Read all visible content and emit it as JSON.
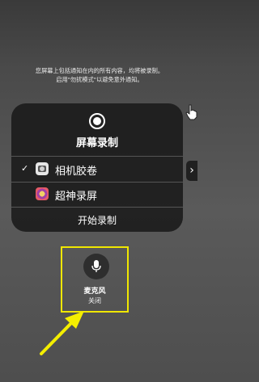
{
  "notice": {
    "line1": "您屏幕上包括通知在内的所有内容，均将被录制。",
    "line2": "启用\"勿扰模式\"以避免意外通知。"
  },
  "card": {
    "title": "屏幕录制",
    "options": [
      {
        "label": "相机胶卷",
        "checked": true,
        "icon": "camera-roll-icon"
      },
      {
        "label": "超神录屏",
        "checked": false,
        "icon": "super-recorder-icon"
      }
    ],
    "start_label": "开始录制"
  },
  "mic": {
    "label": "麦克风",
    "state": "关闭",
    "icon": "microphone-icon"
  },
  "colors": {
    "highlight": "#f0e700"
  }
}
